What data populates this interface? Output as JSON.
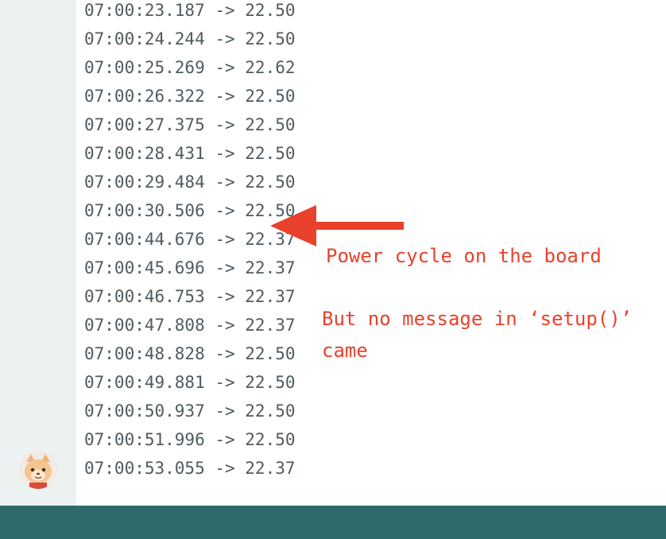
{
  "log": {
    "lines": [
      "07:00:23.187 -> 22.50",
      "07:00:24.244 -> 22.50",
      "07:00:25.269 -> 22.62",
      "07:00:26.322 -> 22.50",
      "07:00:27.375 -> 22.50",
      "07:00:28.431 -> 22.50",
      "07:00:29.484 -> 22.50",
      "07:00:30.506 -> 22.50",
      "07:00:44.676 -> 22.37",
      "07:00:45.696 -> 22.37",
      "07:00:46.753 -> 22.37",
      "07:00:47.808 -> 22.37",
      "07:00:48.828 -> 22.50",
      "07:00:49.881 -> 22.50",
      "07:00:50.937 -> 22.50",
      "07:00:51.996 -> 22.50",
      "07:00:53.055 -> 22.37"
    ]
  },
  "annotation": {
    "power_cycle": "Power cycle on the board",
    "no_message_line1": "But no message in ‘setup()’",
    "no_message_line2": "came",
    "color": "#e8412c"
  },
  "colors": {
    "gutter": "#ecf1f1",
    "footer": "#2e6a6b",
    "log_text": "#4e5b61"
  },
  "icons": {
    "avatar": "cat-avatar-icon",
    "arrow": "left-arrow-icon"
  }
}
